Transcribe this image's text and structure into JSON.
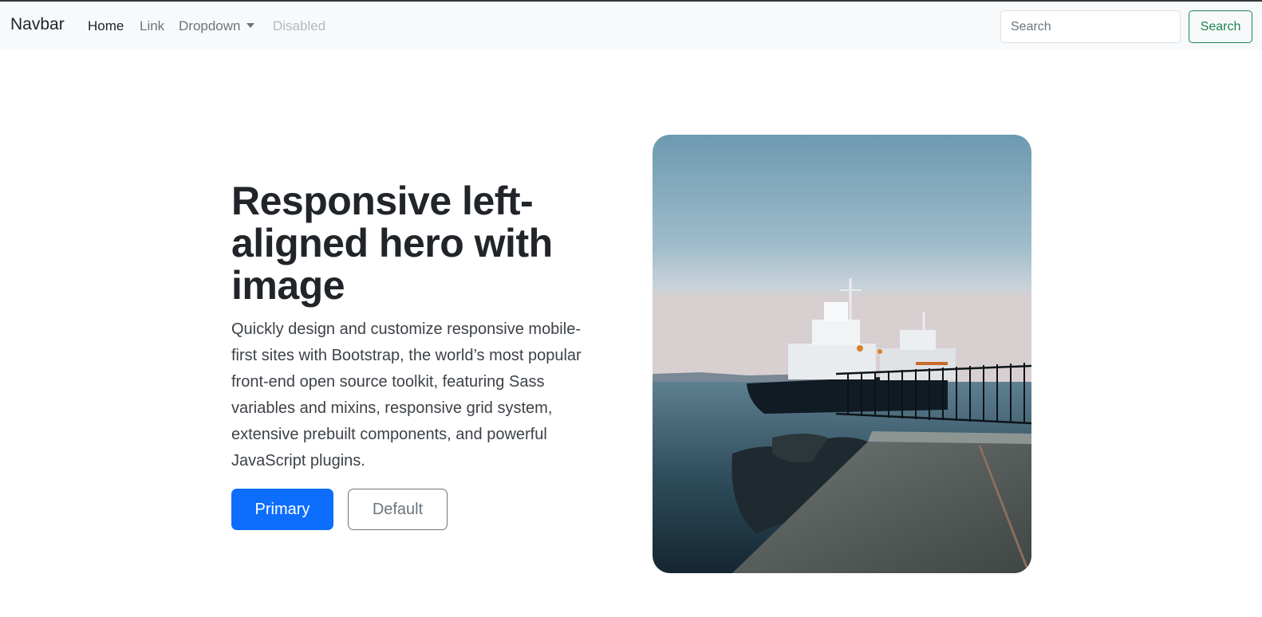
{
  "navbar": {
    "brand": "Navbar",
    "links": [
      {
        "label": "Home",
        "state": "active"
      },
      {
        "label": "Link",
        "state": "normal"
      },
      {
        "label": "Dropdown",
        "state": "normal"
      },
      {
        "label": "Disabled",
        "state": "disabled"
      }
    ],
    "search": {
      "placeholder": "Search",
      "value": "",
      "button_label": "Search"
    }
  },
  "hero": {
    "title": "Responsive left-aligned hero with image",
    "lead": "Quickly design and customize responsive mobile-first sites with Bootstrap, the world’s most popular front-end open source toolkit, featuring Sass variables and mixins, responsive grid system, extensive prebuilt components, and powerful JavaScript plugins.",
    "primary_label": "Primary",
    "default_label": "Default",
    "image_icon": "harbor-tugboats-photo"
  },
  "colors": {
    "primary": "#0d6efd",
    "success": "#198754",
    "navbar_bg": "#f8f9fa",
    "secondary": "#6c757d"
  }
}
